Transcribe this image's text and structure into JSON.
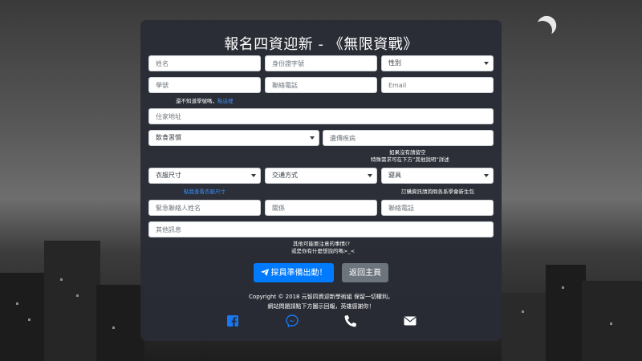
{
  "form": {
    "title": "報名四資迎新 - 《無限資戰》",
    "name_placeholder": "姓名",
    "id_placeholder": "身份證字號",
    "gender_selected": "性別",
    "student_id_placeholder": "學號",
    "phone_placeholder": "聯絡電話",
    "email_placeholder": "Email",
    "student_id_hint_text": "還不知道學號嗎，",
    "student_id_hint_link": "點這裡",
    "address_placeholder": "住家地址",
    "diet_selected": "飲食習慣",
    "illness_placeholder": "遺傳疾病",
    "special_note_line1": "如果沒有請留空",
    "special_note_line2": "特殊需求可在下方”其他說明”詳述",
    "size_selected": "衣服尺寸",
    "transport_selected": "交通方式",
    "bedding_selected": "寢具",
    "size_link": "點我查看衣服尺寸",
    "bedding_note": "訂購資訊請詢問各系學會新生包",
    "emergency_name_placeholder": "緊急聯絡人姓名",
    "relation_placeholder": "關係",
    "emergency_phone_placeholder": "聯絡電話",
    "other_placeholder": "其他訊息",
    "other_note_line1": "其他可能要注意的事情(?",
    "other_note_line2": "或是你有什麼想說的嗎>_<",
    "submit_label": "探員準備出動！",
    "back_label": "返回主頁"
  },
  "footer": {
    "copyright": "Copyright © 2018 元智四資迎新學術組 保留一切權利。",
    "contact_note": "網站問題請點下方圖示回報，英雄感謝你！"
  },
  "icons": [
    "facebook-icon",
    "messenger-icon",
    "phone-icon",
    "envelope-icon"
  ],
  "colors": {
    "panel": "#282c34",
    "primary": "#007bff",
    "secondary": "#6c757d",
    "link": "#3a8df5"
  }
}
